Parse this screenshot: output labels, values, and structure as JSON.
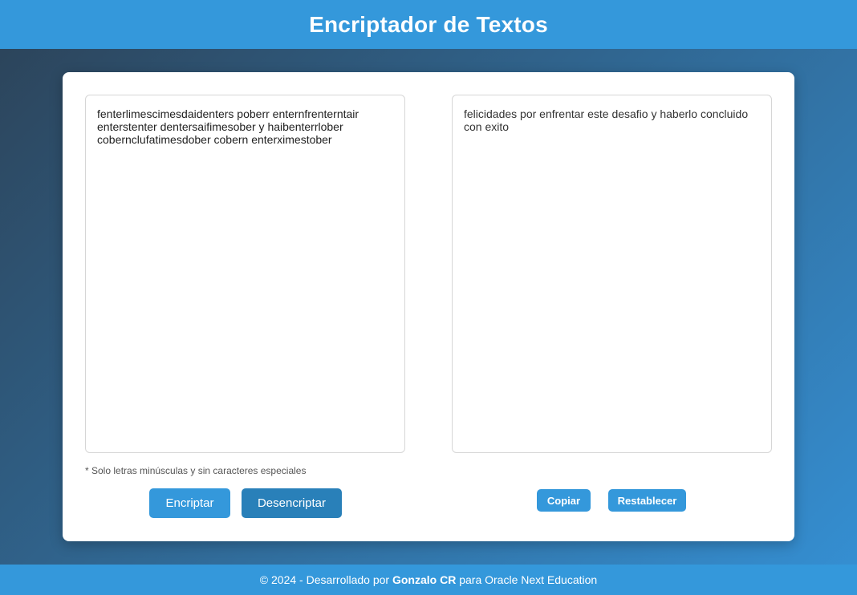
{
  "header": {
    "title": "Encriptador de Textos"
  },
  "input": {
    "value": "fenterlimescimesdaidenters poberr enternfrenterntair enterstenter dentersaifimesober y haibenterrlober cobernclufatimesdober cobern enterximestober"
  },
  "output": {
    "value": "felicidades por enfrentar este desafio y haberlo concluido con exito"
  },
  "note": "* Solo letras minúsculas y sin caracteres especiales",
  "buttons": {
    "encrypt": "Encriptar",
    "decrypt": "Desencriptar",
    "copy": "Copiar",
    "reset": "Restablecer"
  },
  "footer": {
    "prefix": "© 2024 - Desarrollado por ",
    "author": "Gonzalo CR",
    "suffix": " para Oracle Next Education"
  },
  "colors": {
    "primary": "#3498db",
    "primary_dark": "#2980b9"
  }
}
